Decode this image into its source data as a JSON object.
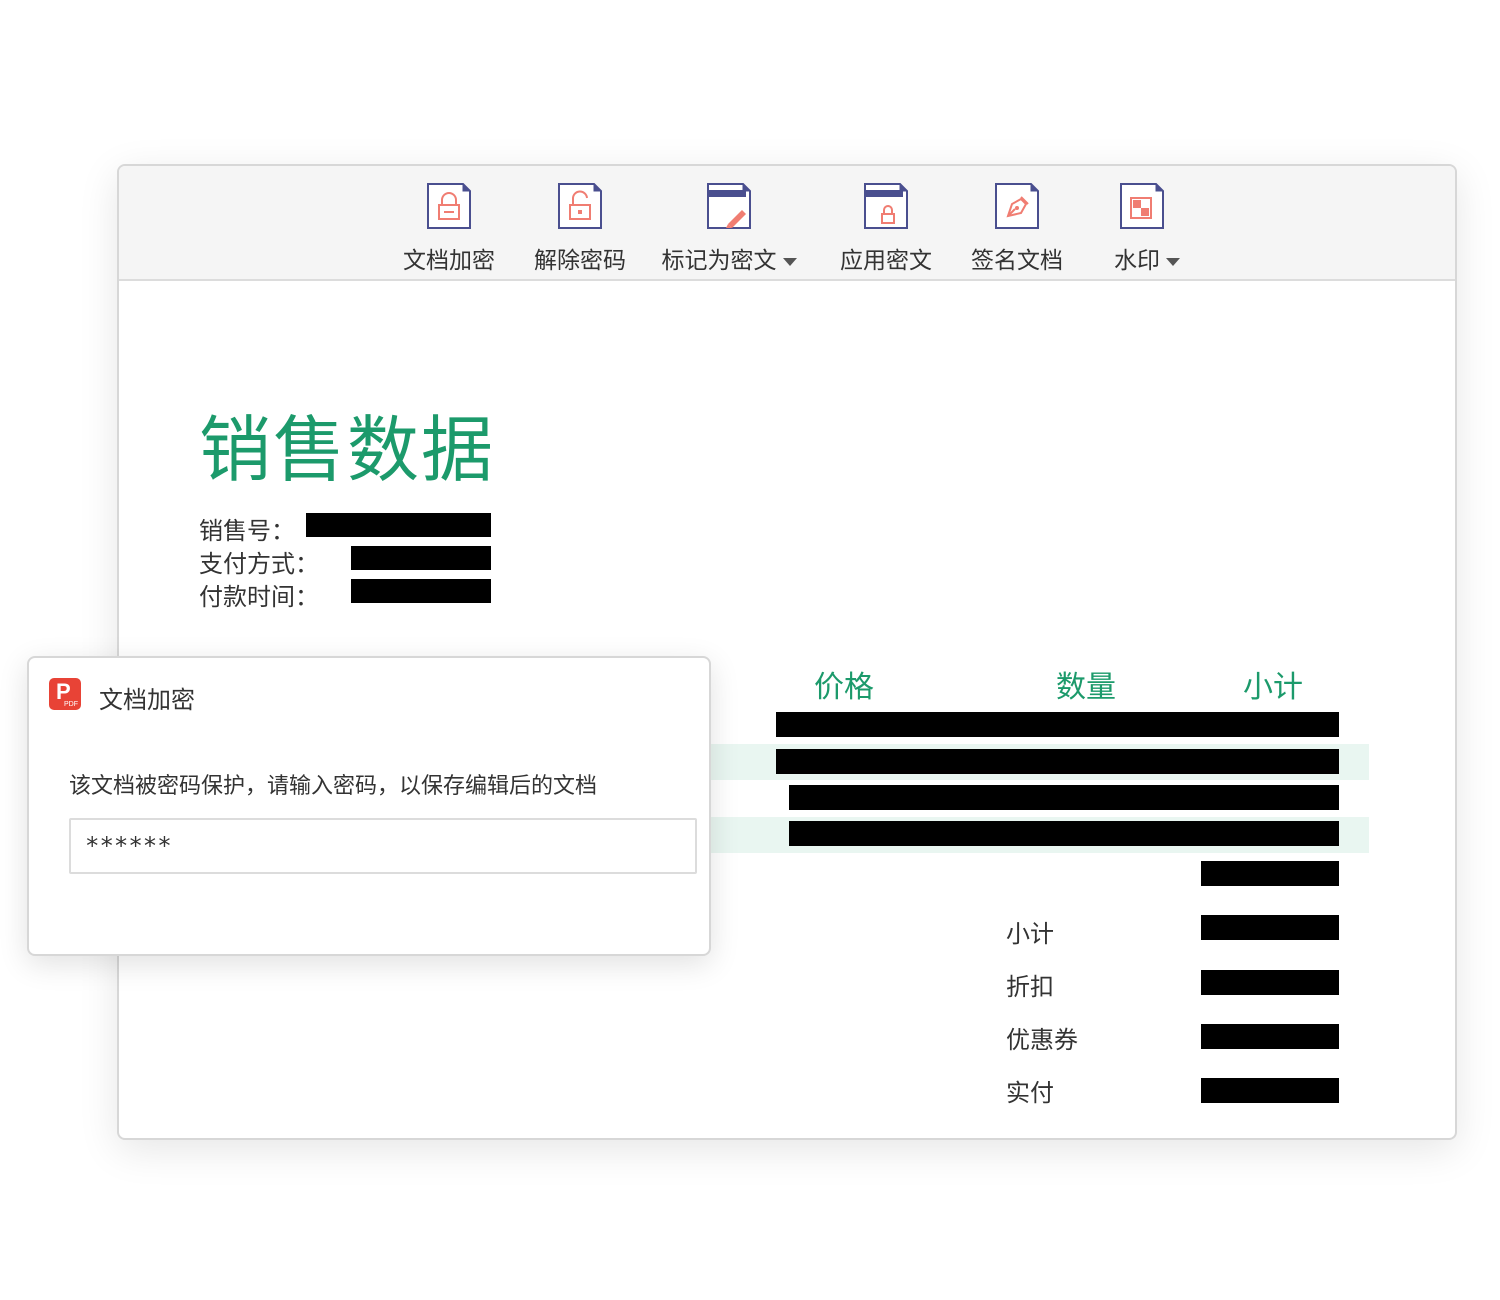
{
  "toolbar": {
    "items": [
      {
        "label": "文档加密",
        "icon": "lock-file-icon"
      },
      {
        "label": "解除密码",
        "icon": "unlock-file-icon"
      },
      {
        "label": "标记为密文",
        "icon": "mark-redact-icon",
        "dropdown": true
      },
      {
        "label": "应用密文",
        "icon": "apply-redact-icon"
      },
      {
        "label": "签名文档",
        "icon": "pen-sign-icon"
      },
      {
        "label": "水印",
        "icon": "watermark-icon",
        "dropdown": true
      }
    ]
  },
  "document": {
    "title": "销售数据",
    "fields": [
      {
        "label": "销售号："
      },
      {
        "label": "支付方式："
      },
      {
        "label": "付款时间："
      }
    ],
    "table_headers": [
      "价格",
      "数量",
      "小计"
    ],
    "summary_labels": [
      "小计",
      "折扣",
      "优惠券",
      "实付"
    ]
  },
  "dialog": {
    "title": "文档加密",
    "message": "该文档被密码保护，请输入密码，以保存编辑后的文档",
    "password_value": "******"
  },
  "colors": {
    "accent_green": "#1c9a6b",
    "icon_navy": "#4a4f8f",
    "icon_coral": "#f07d72",
    "logo_red": "#e84336",
    "redaction": "#000000"
  }
}
